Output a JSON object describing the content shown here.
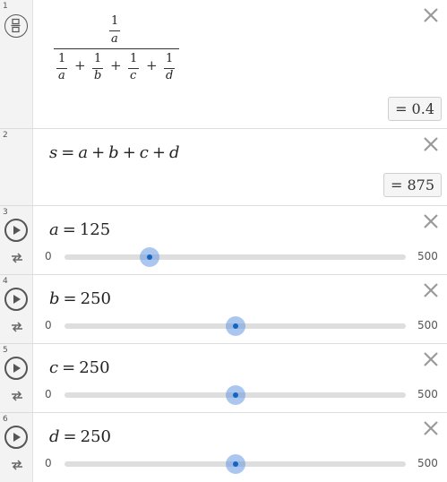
{
  "rows": [
    {
      "number": "1",
      "fraction": {
        "numerator": {
          "one": "1",
          "var": "a"
        },
        "denominator": [
          {
            "one": "1",
            "var": "a"
          },
          {
            "one": "1",
            "var": "b"
          },
          {
            "one": "1",
            "var": "c"
          },
          {
            "one": "1",
            "var": "d"
          }
        ],
        "plus": "+"
      },
      "result": {
        "eq": "=",
        "value": "0.4"
      }
    },
    {
      "number": "2",
      "definition": {
        "lhs": "s",
        "eq": "=",
        "terms": [
          "a",
          "b",
          "c",
          "d"
        ],
        "plus": "+"
      },
      "result": {
        "eq": "=",
        "value": "875"
      }
    }
  ],
  "sliders": [
    {
      "number": "3",
      "name": "a",
      "eq": "=",
      "value": "125",
      "min": "0",
      "max": "500",
      "fraction": 0.25
    },
    {
      "number": "4",
      "name": "b",
      "eq": "=",
      "value": "250",
      "min": "0",
      "max": "500",
      "fraction": 0.5
    },
    {
      "number": "5",
      "name": "c",
      "eq": "=",
      "value": "250",
      "min": "0",
      "max": "500",
      "fraction": 0.5
    },
    {
      "number": "6",
      "name": "d",
      "eq": "=",
      "value": "250",
      "min": "0",
      "max": "500",
      "fraction": 0.5
    }
  ],
  "icons": {
    "close": "close-icon",
    "fraction_toggle": "fraction-toggle-icon",
    "play": "play-icon",
    "repeat": "repeat-icon"
  },
  "colors": {
    "slider_handle": "#1565c0",
    "slider_halo": "#6699e4",
    "track": "#dedede"
  }
}
